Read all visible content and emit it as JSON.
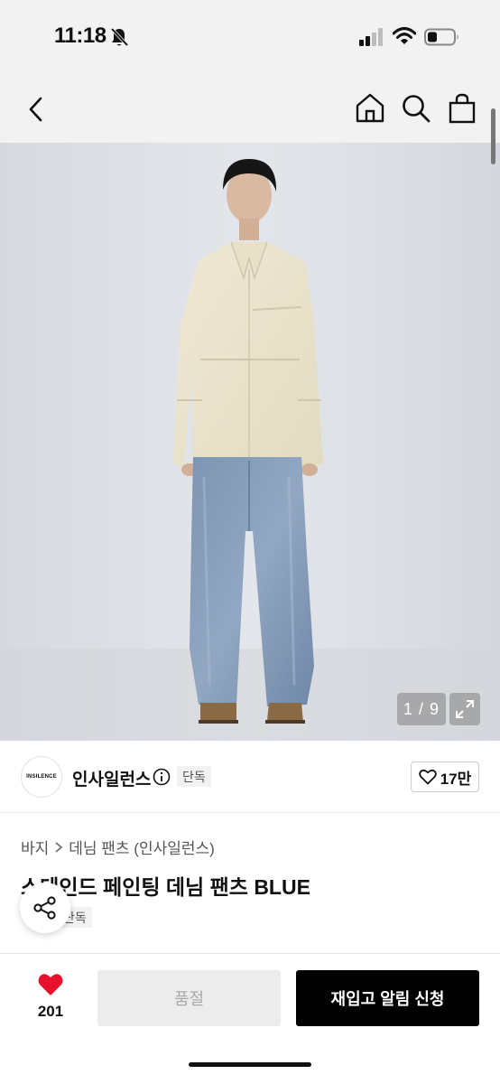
{
  "status_bar": {
    "time": "11:18",
    "icons": [
      "bell-off-icon",
      "signal-icon",
      "wifi-icon",
      "battery-icon"
    ]
  },
  "nav": {
    "icons": [
      "back-icon",
      "home-icon",
      "search-icon",
      "bag-icon"
    ]
  },
  "gallery": {
    "counter": "1 / 9",
    "current": 1,
    "total": 9
  },
  "brand": {
    "logo_text": "INSILENCE",
    "name": "인사일런스",
    "badge": "단독",
    "like_count": "17만"
  },
  "product": {
    "breadcrumb": [
      "바지",
      "데님 팬츠 (인사일런스)"
    ],
    "title": "스테인드 페인팅 데님 팬츠 BLUE",
    "badge": "단독"
  },
  "bottom_bar": {
    "heart_count": "201",
    "soldout_label": "품절",
    "restock_label": "재입고 알림 신청"
  },
  "colors": {
    "accent_heart": "#e8112d",
    "primary_button": "#000000",
    "disabled_button": "#ececec"
  }
}
